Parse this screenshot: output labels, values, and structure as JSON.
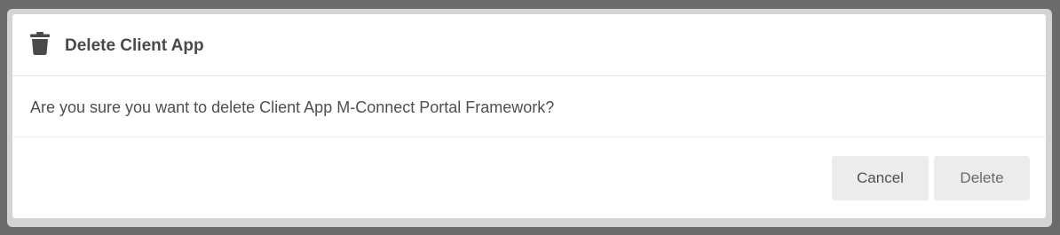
{
  "dialog": {
    "title": "Delete Client App",
    "title_icon": "trash-icon",
    "message": "Are you sure you want to delete Client App M-Connect Portal Framework?",
    "cancel_label": "Cancel",
    "delete_label": "Delete"
  },
  "colors": {
    "backdrop": "#6b6b6b",
    "dialog_background": "#ffffff",
    "button_background": "#ececec",
    "text": "#4a4a4a"
  }
}
